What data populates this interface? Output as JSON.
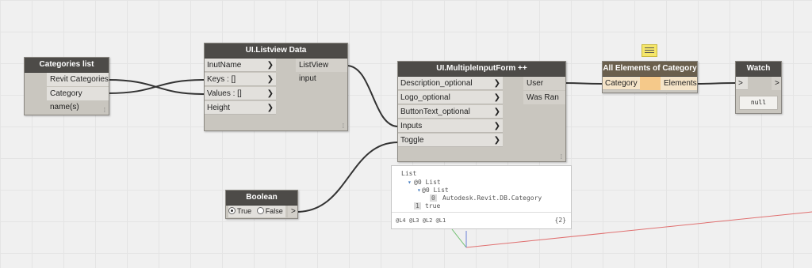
{
  "nodes": {
    "categories_list": {
      "title": "Categories list",
      "outputs": [
        "Revit Categories",
        "Category name(s)"
      ],
      "grip": "⁞"
    },
    "listview": {
      "title": "UI.Listview Data",
      "inputs": [
        "InutName",
        "Keys : []",
        "Values : []",
        "Height"
      ],
      "output": "ListView input",
      "grip": "⁞"
    },
    "multiinput": {
      "title": "UI.MultipleInputForm ++",
      "inputs": [
        "Description_optional",
        "Logo_optional",
        "ButtonText_optional",
        "Inputs",
        "Toggle"
      ],
      "outputs": [
        "User Inputs",
        "Was Ran"
      ],
      "grip": "⁞"
    },
    "all_elements": {
      "title": "All Elements of Category",
      "input": "Category",
      "output": "Elements"
    },
    "watch": {
      "title": "Watch",
      "in": ">",
      "out": ">",
      "value": "null"
    },
    "boolean": {
      "title": "Boolean",
      "true_label": "True",
      "false_label": "False",
      "out": ">",
      "selected": "True"
    }
  },
  "preview": {
    "line1": "List",
    "line2": "@0 List",
    "line3": "@0 List",
    "line4_idx": "0",
    "line4_val": "Autodesk.Revit.DB.Category",
    "line5_idx": "1",
    "line5_val": "true",
    "footer_levels": "@L4 @L3 @L2 @L1",
    "footer_count": "{2}"
  },
  "arrow_glyph": "❯",
  "colors": {
    "wire": "#333333",
    "highlight_port": "#f5c98a",
    "comment_icon": "#f5e66a"
  }
}
